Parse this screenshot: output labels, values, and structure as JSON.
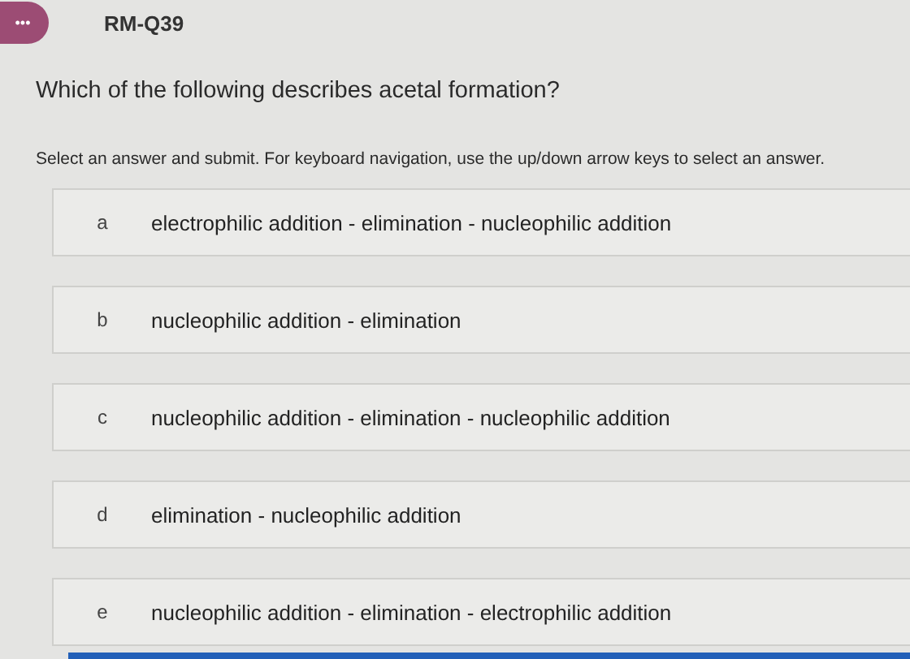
{
  "header": {
    "menu_icon": "•••",
    "title": "RM-Q39"
  },
  "question": "Which of the following describes acetal formation?",
  "instructions": "Select an answer and submit. For keyboard navigation, use the up/down arrow keys to select an answer.",
  "options": [
    {
      "letter": "a",
      "text": "electrophilic addition - elimination - nucleophilic addition",
      "selected": false
    },
    {
      "letter": "b",
      "text": "nucleophilic addition - elimination",
      "selected": false
    },
    {
      "letter": "c",
      "text": "nucleophilic addition - elimination - nucleophilic addition",
      "selected": false
    },
    {
      "letter": "d",
      "text": "elimination - nucleophilic addition",
      "selected": false
    },
    {
      "letter": "e",
      "text": "nucleophilic addition - elimination - electrophilic addition",
      "selected": false
    }
  ]
}
